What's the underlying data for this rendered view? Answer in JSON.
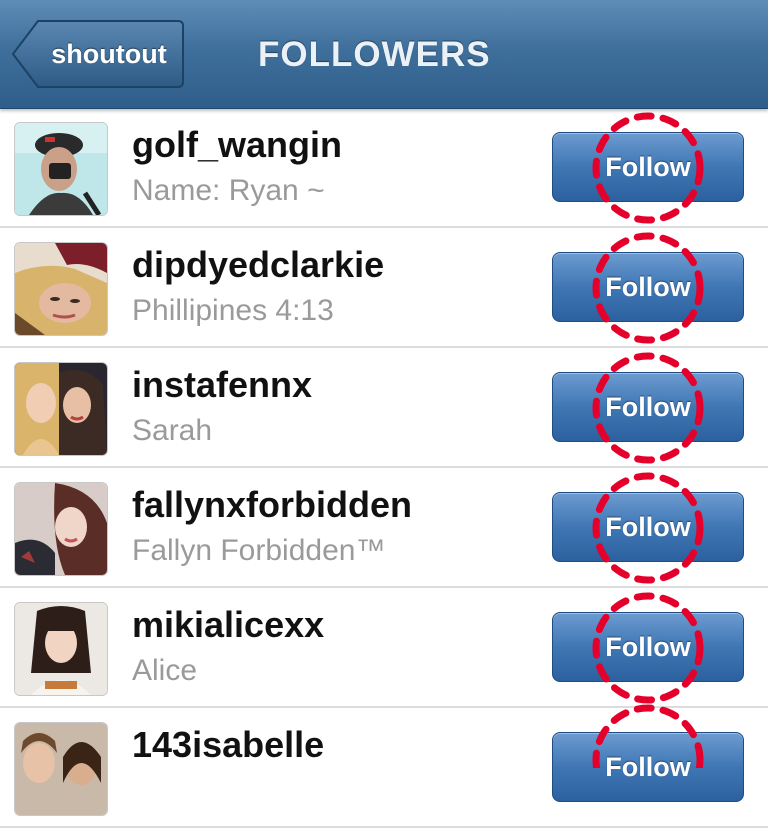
{
  "navbar": {
    "back_label": "shoutout",
    "title": "FOLLOWERS"
  },
  "follow_label": "Follow",
  "followers": [
    {
      "username": "golf_wangin",
      "fullname": "Name: Ryan ~"
    },
    {
      "username": "dipdyedclarkie",
      "fullname": "Phillipines 4:13"
    },
    {
      "username": "instafennx",
      "fullname": "Sarah"
    },
    {
      "username": "fallynxforbidden",
      "fullname": "Fallyn Forbidden™"
    },
    {
      "username": "mikialicexx",
      "fullname": "Alice"
    },
    {
      "username": "143isabelle",
      "fullname": ""
    }
  ],
  "colors": {
    "navbar": "#3f6f9b",
    "button": "#3f77b4",
    "annotation": "#e4002b"
  }
}
